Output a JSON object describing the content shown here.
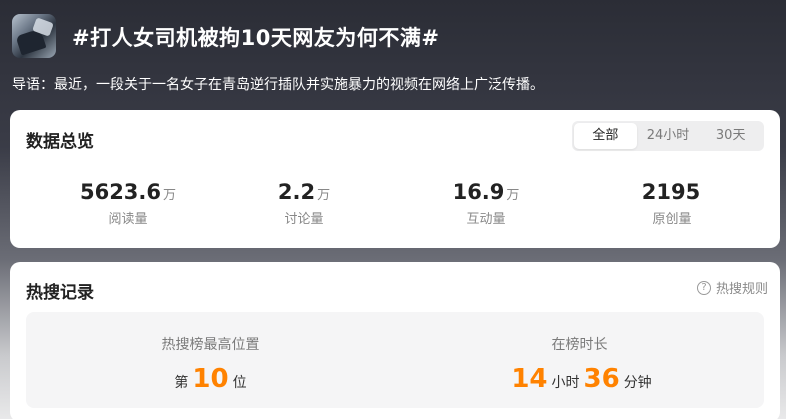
{
  "header": {
    "title": "#打人女司机被拘10天网友为何不满#",
    "intro": "导语：最近，一段关于一名女子在青岛逆行插队并实施暴力的视频在网络上广泛传播。"
  },
  "overview": {
    "title": "数据总览",
    "tabs": [
      {
        "label": "全部",
        "active": true
      },
      {
        "label": "24小时",
        "active": false
      },
      {
        "label": "30天",
        "active": false
      }
    ],
    "stats": [
      {
        "value": "5623.6",
        "unit": "万",
        "label": "阅读量"
      },
      {
        "value": "2.2",
        "unit": "万",
        "label": "讨论量"
      },
      {
        "value": "16.9",
        "unit": "万",
        "label": "互动量"
      },
      {
        "value": "2195",
        "unit": "",
        "label": "原创量"
      }
    ]
  },
  "hot_search": {
    "title": "热搜记录",
    "rules_label": "热搜规则",
    "rules_icon": "question-icon",
    "peak": {
      "label": "热搜榜最高位置",
      "prefix": "第",
      "value": "10",
      "suffix": "位"
    },
    "duration": {
      "label": "在榜时长",
      "hours": "14",
      "hours_unit": "小时",
      "minutes": "36",
      "minutes_unit": "分钟"
    },
    "accent_color": "#ff8200"
  }
}
